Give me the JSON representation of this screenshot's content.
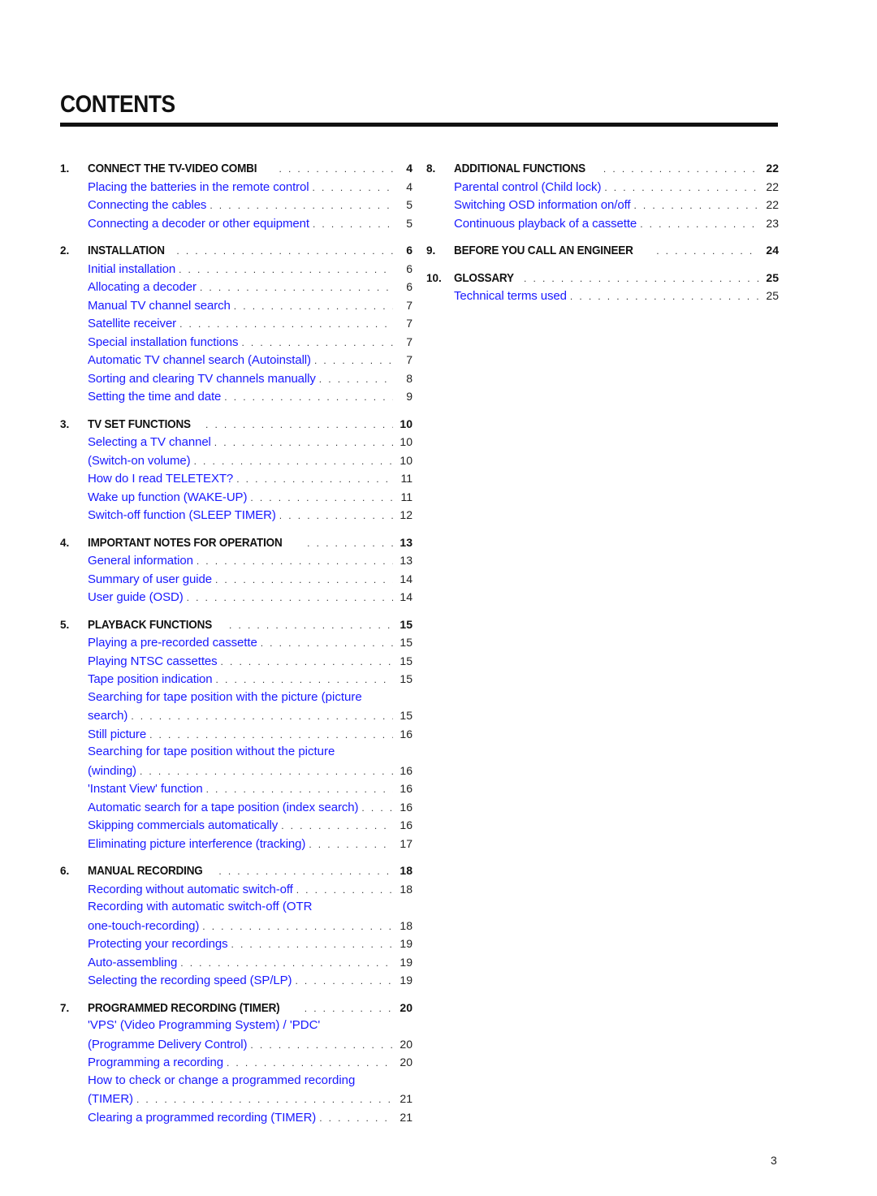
{
  "title": "CONTENTS",
  "page_number": "3",
  "columns": [
    {
      "sections": [
        {
          "number": "1.",
          "heading": "CONNECT THE TV-VIDEO COMBI",
          "page": "4",
          "items": [
            {
              "label": "Placing the batteries in the remote control",
              "page": "4"
            },
            {
              "label": "Connecting the cables",
              "page": "5"
            },
            {
              "label": "Connecting a decoder or other equipment",
              "page": "5"
            }
          ]
        },
        {
          "number": "2.",
          "heading": "INSTALLATION",
          "page": "6",
          "items": [
            {
              "label": "Initial installation",
              "page": "6"
            },
            {
              "label": "Allocating a decoder",
              "page": "6"
            },
            {
              "label": "Manual TV channel search",
              "page": "7"
            },
            {
              "label": "Satellite receiver",
              "page": "7"
            },
            {
              "label": "Special installation functions",
              "page": "7"
            },
            {
              "label": "Automatic TV channel search (Autoinstall)",
              "page": "7"
            },
            {
              "label": "Sorting and clearing TV channels manually",
              "page": "8"
            },
            {
              "label": "Setting the time and date",
              "page": "9"
            }
          ]
        },
        {
          "number": "3.",
          "heading": "TV SET FUNCTIONS",
          "page": "10",
          "items": [
            {
              "label": "Selecting a TV channel",
              "page": "10"
            },
            {
              "label": "(Switch-on volume)",
              "page": "10"
            },
            {
              "label": "How do I read TELETEXT?",
              "page": "11"
            },
            {
              "label": "Wake up function (WAKE-UP)",
              "page": "11"
            },
            {
              "label": "Switch-off function (SLEEP TIMER)",
              "page": "12"
            }
          ]
        },
        {
          "number": "4.",
          "heading": "IMPORTANT NOTES FOR OPERATION",
          "page": "13",
          "items": [
            {
              "label": "General information",
              "page": "13"
            },
            {
              "label": "Summary of user guide",
              "page": "14"
            },
            {
              "label": "User guide (OSD)",
              "page": "14"
            }
          ]
        },
        {
          "number": "5.",
          "heading": "PLAYBACK FUNCTIONS",
          "page": "15",
          "items": [
            {
              "label": "Playing a pre-recorded cassette",
              "page": "15"
            },
            {
              "label": "Playing NTSC cassettes",
              "page": "15"
            },
            {
              "label": "Tape position indication",
              "page": "15"
            },
            {
              "label_line1": "Searching for tape position with the picture (picture",
              "label": "search)",
              "page": "15"
            },
            {
              "label": "Still picture",
              "page": "16"
            },
            {
              "label_line1": "Searching for tape position without the picture",
              "label": "(winding)",
              "page": "16"
            },
            {
              "label": "'Instant View' function",
              "page": "16"
            },
            {
              "label": "Automatic search for a tape position (index search)",
              "page": "16"
            },
            {
              "label": "Skipping commercials automatically",
              "page": "16"
            },
            {
              "label": "Eliminating picture interference (tracking)",
              "page": "17"
            }
          ]
        },
        {
          "number": "6.",
          "heading": "MANUAL RECORDING",
          "page": "18",
          "items": [
            {
              "label": "Recording without automatic switch-off",
              "page": "18"
            },
            {
              "label_line1": "Recording with automatic switch-off (OTR",
              "label": "one-touch-recording)",
              "page": "18"
            },
            {
              "label": "Protecting your recordings",
              "page": "19"
            },
            {
              "label": "Auto-assembling",
              "page": "19"
            },
            {
              "label": "Selecting the recording speed (SP/LP)",
              "page": "19"
            }
          ]
        },
        {
          "number": "7.",
          "heading": "PROGRAMMED RECORDING (TIMER)",
          "page": "20",
          "items": [
            {
              "label_line1": "'VPS' (Video Programming System) / 'PDC'",
              "label": "(Programme Delivery Control)",
              "page": "20"
            },
            {
              "label": "Programming a recording",
              "page": "20"
            },
            {
              "label_line1": "How to check or change a programmed recording",
              "label": "(TIMER)",
              "page": "21"
            },
            {
              "label": "Clearing a programmed recording (TIMER)",
              "page": "21"
            }
          ]
        }
      ]
    },
    {
      "sections": [
        {
          "number": "8.",
          "heading": "ADDITIONAL FUNCTIONS",
          "page": "22",
          "items": [
            {
              "label": "Parental control (Child lock)",
              "page": "22"
            },
            {
              "label": "Switching OSD information on/off",
              "page": "22"
            },
            {
              "label": "Continuous playback of a cassette",
              "page": "23"
            }
          ]
        },
        {
          "number": "9.",
          "heading": "BEFORE YOU CALL AN ENGINEER",
          "page": "24",
          "items": []
        },
        {
          "number": "10.",
          "heading": "GLOSSARY",
          "page": "25",
          "items": [
            {
              "label": "Technical terms used",
              "page": "25"
            }
          ]
        }
      ]
    }
  ],
  "colors": {
    "link": "#1a1aff",
    "text": "#111111",
    "rule": "#111111"
  }
}
